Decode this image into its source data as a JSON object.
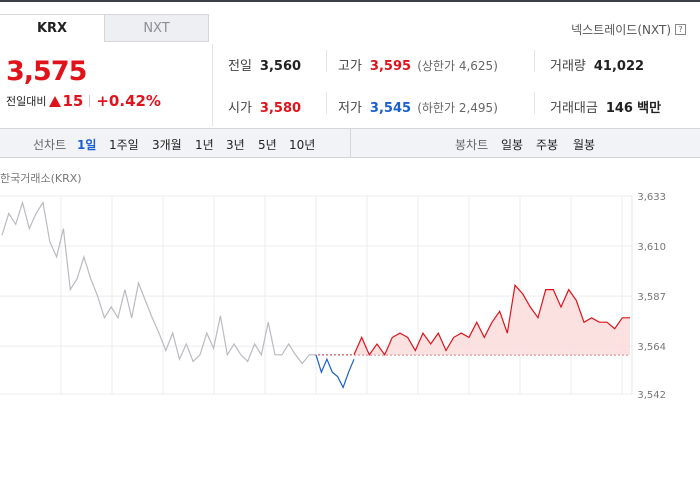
{
  "tabs": [
    {
      "label": "KRX",
      "active": true
    },
    {
      "label": "NXT",
      "active": false
    }
  ],
  "nxt_link": {
    "label": "넥스트레이드(NXT)",
    "help_icon": "?"
  },
  "price": {
    "current": "3,575",
    "change_label": "전일대비",
    "change_value": "15",
    "change_pct": "+0.42%",
    "direction": "up"
  },
  "stats": {
    "prev_close": {
      "label": "전일",
      "value": "3,560"
    },
    "high": {
      "label": "고가",
      "value": "3,595",
      "limit_label": "상한가",
      "limit_value": "4,625"
    },
    "volume": {
      "label": "거래량",
      "value": "41,022"
    },
    "open": {
      "label": "시가",
      "value": "3,580"
    },
    "low": {
      "label": "저가",
      "value": "3,545",
      "limit_label": "하한가",
      "limit_value": "2,495"
    },
    "amount": {
      "label": "거래대금",
      "value": "146",
      "unit": "백만"
    }
  },
  "period_bar": {
    "line_label": "선차트",
    "line_options": [
      "1일",
      "1주일",
      "3개월",
      "1년",
      "3년",
      "5년",
      "10년"
    ],
    "line_active": "1일",
    "candle_label": "봉차트",
    "candle_options": [
      "일봉",
      "주봉",
      "월봉"
    ]
  },
  "exchange_label": "한국거래소(KRX)",
  "colors": {
    "up": "#e0131b",
    "down": "#1a5fd1",
    "prev_series": "#b9bbc0",
    "fill": "#fbdcdc"
  },
  "chart_data": {
    "type": "line",
    "title": "",
    "xlabel": "",
    "ylabel": "",
    "y_ticks": [
      "3,633",
      "3,610",
      "3,587",
      "3,564",
      "3,542"
    ],
    "ylim": [
      3542,
      3633
    ],
    "baseline": 3560,
    "grid": true,
    "series": [
      {
        "role": "previous",
        "values": [
          3615,
          3625,
          3620,
          3630,
          3618,
          3625,
          3630,
          3612,
          3605,
          3618,
          3590,
          3595,
          3605,
          3595,
          3587,
          3577,
          3582,
          3577,
          3590,
          3577,
          3593,
          3585,
          3577,
          3570,
          3562,
          3570,
          3558,
          3565,
          3557,
          3560,
          3570,
          3563,
          3578,
          3560,
          3565,
          3560,
          3557,
          3565,
          3560,
          3575,
          3560,
          3560,
          3565,
          3560,
          3556,
          3560,
          3560
        ]
      },
      {
        "role": "today_down",
        "values": [
          3560,
          3552,
          3558,
          3552,
          3550,
          3545,
          3552,
          3558
        ]
      },
      {
        "role": "today_up",
        "values": [
          3560,
          3568,
          3560,
          3565,
          3560,
          3568,
          3570,
          3568,
          3562,
          3570,
          3565,
          3570,
          3562,
          3568,
          3570,
          3568,
          3575,
          3568,
          3575,
          3580,
          3570,
          3592,
          3588,
          3582,
          3577,
          3590,
          3590,
          3582,
          3590,
          3585,
          3575,
          3577,
          3575,
          3575,
          3572,
          3577,
          3577
        ]
      }
    ]
  }
}
